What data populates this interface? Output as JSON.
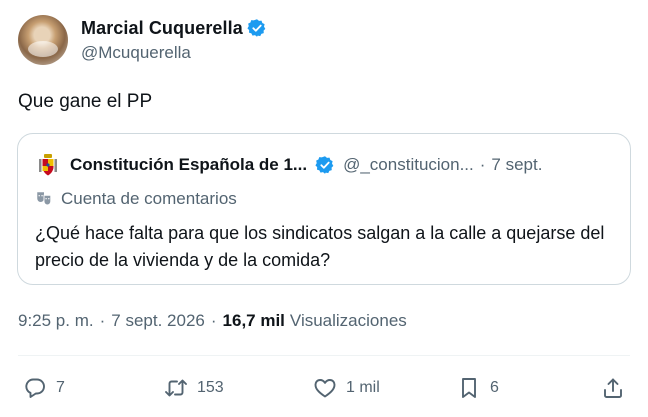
{
  "author": {
    "display_name": "Marcial Cuquerella",
    "handle": "@Mcuquerella",
    "verified": true
  },
  "tweet": {
    "text": "Que gane el PP"
  },
  "quoted": {
    "display_name": "Constitución Española de 1...",
    "handle": "@_constitucion...",
    "separator": "·",
    "time": "7 sept.",
    "label": "Cuenta de comentarios",
    "text": "¿Qué hace falta para que los sindicatos salgan a la calle a quejarse del precio de la vivienda y de la comida?"
  },
  "meta": {
    "time": "9:25 p. m.",
    "sep": "·",
    "date": "7 sept. 2026",
    "views_count": "16,7 mil",
    "views_label": "Visualizaciones"
  },
  "actions": {
    "replies": "7",
    "retweets": "153",
    "likes": "1 mil",
    "bookmarks": "6"
  },
  "colors": {
    "verified": "#1d9bf0",
    "secondary_text": "#536471",
    "primary_text": "#0f1419",
    "border": "#cfd9de"
  }
}
